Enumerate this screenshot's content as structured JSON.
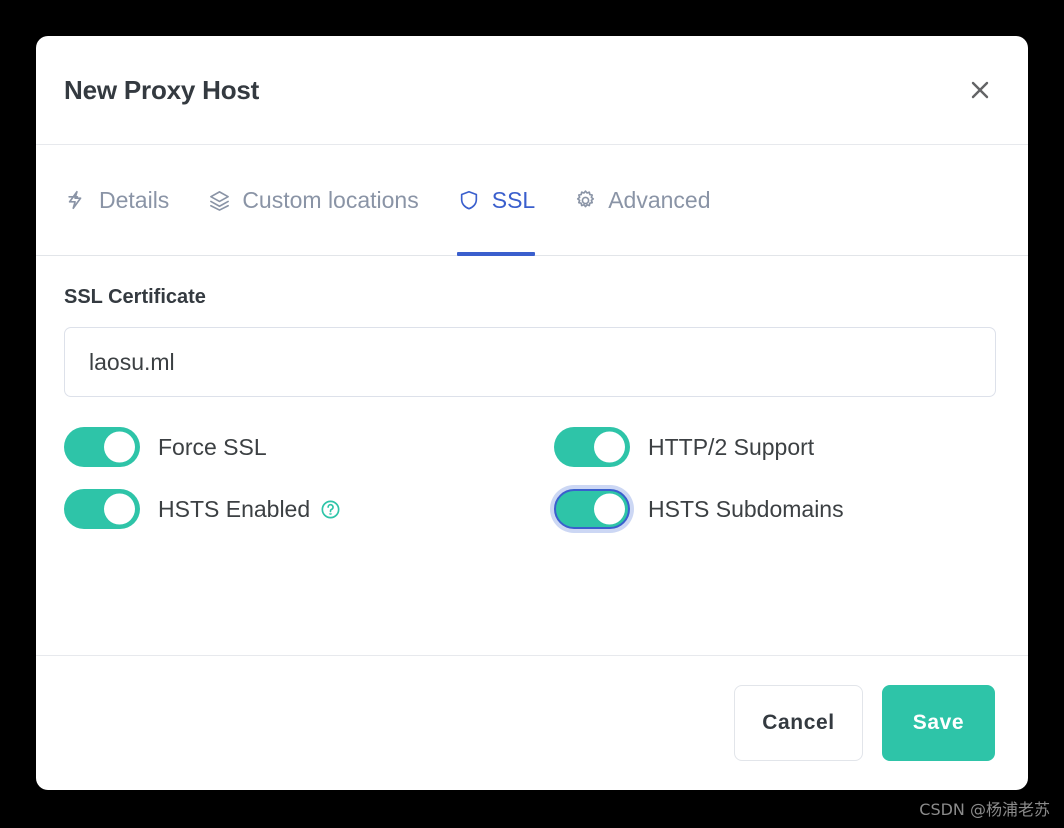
{
  "background_color": "#000000",
  "accent_color": "#2ec4a8",
  "active_tab_color": "#3a5fcd",
  "dialog": {
    "title": "New Proxy Host",
    "close_icon": "close-x-icon"
  },
  "tabs": [
    {
      "id": "details",
      "label": "Details",
      "icon": "lightning-bolt-icon",
      "active": false
    },
    {
      "id": "custom-locations",
      "label": "Custom locations",
      "icon": "layers-icon",
      "active": false
    },
    {
      "id": "ssl",
      "label": "SSL",
      "icon": "shield-icon",
      "active": true
    },
    {
      "id": "advanced",
      "label": "Advanced",
      "icon": "gear-icon",
      "active": false
    }
  ],
  "form": {
    "certificate_label": "SSL Certificate",
    "certificate_value": "laosu.ml"
  },
  "toggles": [
    {
      "id": "force-ssl",
      "label": "Force SSL",
      "on": true,
      "focused": false,
      "help": false
    },
    {
      "id": "http2-support",
      "label": "HTTP/2 Support",
      "on": true,
      "focused": false,
      "help": false
    },
    {
      "id": "hsts-enabled",
      "label": "HSTS Enabled",
      "on": true,
      "focused": false,
      "help": true,
      "help_icon": "question-circle-icon"
    },
    {
      "id": "hsts-subdomains",
      "label": "HSTS Subdomains",
      "on": true,
      "focused": true,
      "help": false
    }
  ],
  "footer": {
    "cancel_label": "Cancel",
    "save_label": "Save"
  },
  "watermark": {
    "text": "CSDN @杨浦老苏"
  }
}
